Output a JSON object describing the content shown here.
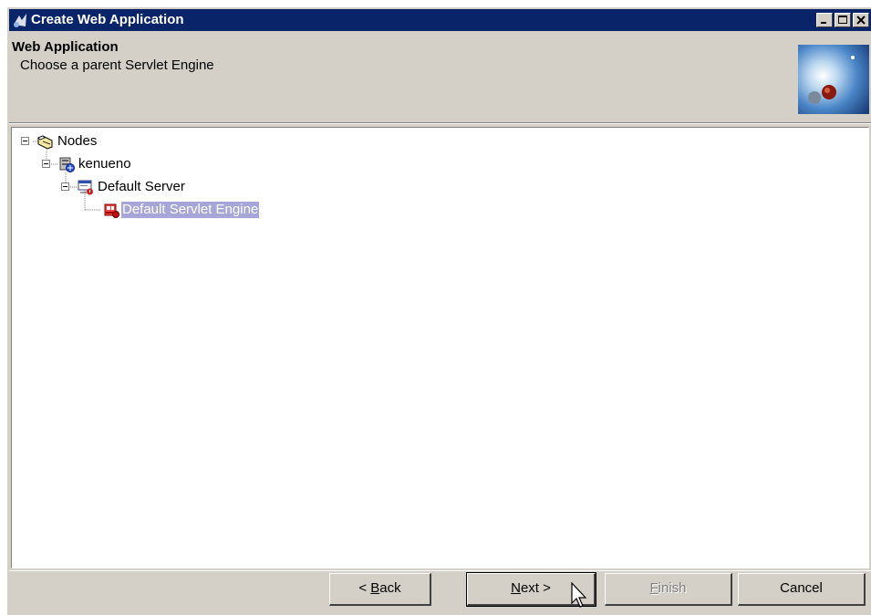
{
  "window": {
    "title": "Create Web Application",
    "title_bar_color": "#0a246a",
    "controls": [
      "minimize-icon",
      "maximize-icon",
      "close-icon"
    ]
  },
  "header": {
    "title": "Web Application",
    "subtitle": "Choose a parent Servlet Engine"
  },
  "tree": {
    "nodes": [
      {
        "label": "Nodes",
        "icon": "folder-icon",
        "expanded": true,
        "selected": false
      },
      {
        "label": "kenueno",
        "icon": "node-server-icon",
        "expanded": true,
        "selected": false
      },
      {
        "label": "Default Server",
        "icon": "application-server-icon",
        "expanded": true,
        "selected": false
      },
      {
        "label": "Default Servlet Engine",
        "icon": "servlet-engine-icon",
        "expanded": false,
        "selected": true
      }
    ],
    "selection_color": "#a6a6d8"
  },
  "buttons": {
    "back": {
      "prefix": "< ",
      "mnemonic": "B",
      "rest": "ack",
      "enabled": true
    },
    "next": {
      "mnemonic": "N",
      "rest": "ext >",
      "enabled": true
    },
    "finish": {
      "mnemonic": "F",
      "rest": "inish",
      "enabled": false
    },
    "cancel": {
      "label": "Cancel",
      "enabled": true
    }
  }
}
